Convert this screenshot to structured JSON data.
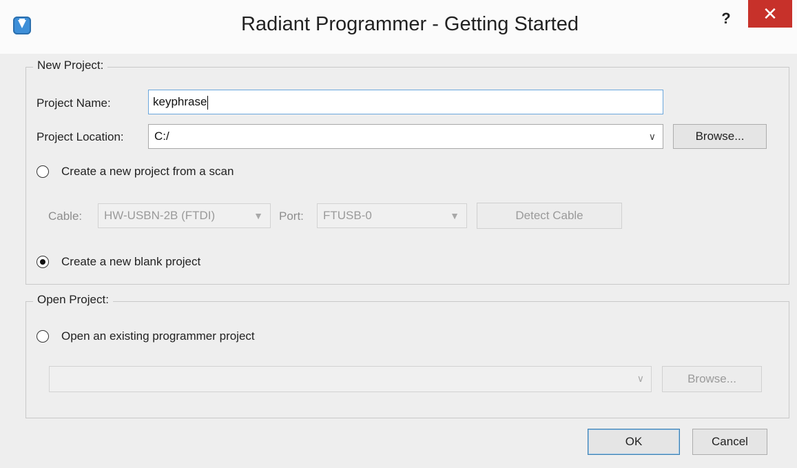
{
  "window": {
    "title": "Radiant Programmer - Getting Started",
    "help_glyph": "?",
    "close_glyph": "✕",
    "accent_close": "#c7312a"
  },
  "new_project": {
    "legend": "New Project:",
    "name_label": "Project Name:",
    "name_value": "keyphrase",
    "location_label": "Project Location:",
    "location_value": "C:/",
    "browse_label": "Browse...",
    "scan_option_label": "Create a new project from a scan",
    "scan_option_checked": false,
    "cable_label": "Cable:",
    "cable_value": "HW-USBN-2B (FTDI)",
    "port_label": "Port:",
    "port_value": "FTUSB-0",
    "detect_cable_label": "Detect Cable",
    "blank_option_label": "Create a new blank project",
    "blank_option_checked": true
  },
  "open_project": {
    "legend": "Open Project:",
    "existing_option_label": "Open an existing programmer project",
    "existing_option_checked": false,
    "path_value": "",
    "browse_label": "Browse..."
  },
  "footer": {
    "ok_label": "OK",
    "cancel_label": "Cancel"
  }
}
